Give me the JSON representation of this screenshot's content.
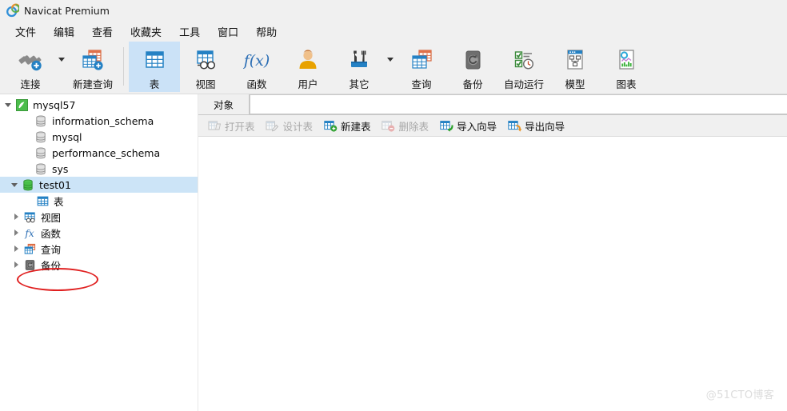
{
  "window": {
    "title": "Navicat Premium",
    "logo_icon": "navicat-logo-icon"
  },
  "menubar": {
    "items": [
      {
        "label": "文件",
        "name": "menu-file"
      },
      {
        "label": "编辑",
        "name": "menu-edit"
      },
      {
        "label": "查看",
        "name": "menu-view"
      },
      {
        "label": "收藏夹",
        "name": "menu-favorites"
      },
      {
        "label": "工具",
        "name": "menu-tools"
      },
      {
        "label": "窗口",
        "name": "menu-window"
      },
      {
        "label": "帮助",
        "name": "menu-help"
      }
    ]
  },
  "toolbar": {
    "buttons": [
      {
        "label": "连接",
        "icon": "connection-plug-icon",
        "selected": false,
        "has_caret": true
      },
      {
        "label": "新建查询",
        "icon": "new-query-icon",
        "selected": false,
        "has_caret": false
      },
      {
        "label": "表",
        "icon": "table-icon",
        "selected": true,
        "has_caret": false
      },
      {
        "label": "视图",
        "icon": "view-icon",
        "selected": false,
        "has_caret": false
      },
      {
        "label": "函数",
        "icon": "function-fx-icon",
        "selected": false,
        "has_caret": false
      },
      {
        "label": "用户",
        "icon": "user-icon",
        "selected": false,
        "has_caret": false
      },
      {
        "label": "其它",
        "icon": "other-tools-icon",
        "selected": false,
        "has_caret": true
      },
      {
        "label": "查询",
        "icon": "query-icon",
        "selected": false,
        "has_caret": false
      },
      {
        "label": "备份",
        "icon": "backup-icon",
        "selected": false,
        "has_caret": false
      },
      {
        "label": "自动运行",
        "icon": "automation-icon",
        "selected": false,
        "has_caret": false
      },
      {
        "label": "模型",
        "icon": "model-icon",
        "selected": false,
        "has_caret": false
      },
      {
        "label": "图表",
        "icon": "chart-icon",
        "selected": false,
        "has_caret": false
      }
    ]
  },
  "sidebar": {
    "connection": {
      "label": "mysql57",
      "icon": "mysql-connection-icon",
      "expanded": true
    },
    "databases": [
      {
        "label": "information_schema",
        "icon": "database-icon",
        "selected": false,
        "expandable": false,
        "expanded": false
      },
      {
        "label": "mysql",
        "icon": "database-icon",
        "selected": false,
        "expandable": false,
        "expanded": false
      },
      {
        "label": "performance_schema",
        "icon": "database-icon",
        "selected": false,
        "expandable": false,
        "expanded": false
      },
      {
        "label": "sys",
        "icon": "database-icon",
        "selected": false,
        "expandable": false,
        "expanded": false
      },
      {
        "label": "test01",
        "icon": "database-open-icon",
        "selected": true,
        "expandable": true,
        "expanded": true
      }
    ],
    "test01_children": [
      {
        "label": "表",
        "icon": "table-icon",
        "expandable": false
      },
      {
        "label": "视图",
        "icon": "view-icon",
        "expandable": true
      },
      {
        "label": "函数",
        "icon": "function-fx-icon",
        "expandable": true
      },
      {
        "label": "查询",
        "icon": "query-icon",
        "expandable": true
      },
      {
        "label": "备份",
        "icon": "backup-icon",
        "expandable": true
      }
    ],
    "annotation": {
      "shape": "red-ellipse",
      "target": "test01",
      "color": "#e02020"
    }
  },
  "content": {
    "tabs": [
      {
        "label": "对象",
        "active": true
      }
    ],
    "object_toolbar": [
      {
        "label": "打开表",
        "icon": "open-table-icon",
        "enabled": false
      },
      {
        "label": "设计表",
        "icon": "design-table-icon",
        "enabled": false
      },
      {
        "label": "新建表",
        "icon": "new-table-icon",
        "enabled": true
      },
      {
        "label": "删除表",
        "icon": "delete-table-icon",
        "enabled": false
      },
      {
        "label": "导入向导",
        "icon": "import-wizard-icon",
        "enabled": true
      },
      {
        "label": "导出向导",
        "icon": "export-wizard-icon",
        "enabled": true
      }
    ]
  },
  "watermark": {
    "text": "@51CTO博客"
  },
  "colors": {
    "chrome": "#f0f0f0",
    "selection": "#cce4f7",
    "toolbar_selection": "#cbe2f7",
    "accent_blue": "#1a7cc7",
    "annotation_red": "#e02020",
    "disabled_text": "#a8a8a8"
  }
}
